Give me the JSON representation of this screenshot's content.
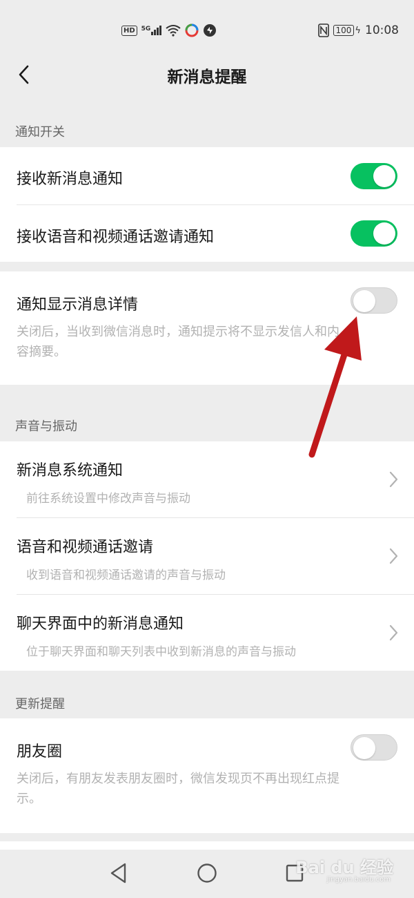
{
  "status_bar": {
    "hd": "HD",
    "network": "5G",
    "battery": "100",
    "time": "10:08"
  },
  "header": {
    "title": "新消息提醒"
  },
  "sections": {
    "notify_switch": {
      "label": "通知开关",
      "receive_new": {
        "title": "接收新消息通知",
        "enabled": true
      },
      "receive_call": {
        "title": "接收语音和视频通话邀请通知",
        "enabled": true
      },
      "show_details": {
        "title": "通知显示消息详情",
        "enabled": false,
        "desc_line1": "关闭后，当收到微信消息时，通知提示将不显示发信人和内",
        "desc_line2": "容摘要。"
      }
    },
    "sound_vibration": {
      "label": "声音与振动",
      "items": [
        {
          "title": "新消息系统通知",
          "subtitle": "前往系统设置中修改声音与振动"
        },
        {
          "title": "语音和视频通话邀请",
          "subtitle": "收到语音和视频通话邀请的声音与振动"
        },
        {
          "title": "聊天界面中的新消息通知",
          "subtitle": "位于聊天界面和聊天列表中收到新消息的声音与振动"
        }
      ]
    },
    "update_reminder": {
      "label": "更新提醒",
      "moments": {
        "title": "朋友圈",
        "enabled": false,
        "desc_line1": "关闭后，有朋友发表朋友圈时，微信发现页不再出现红点提",
        "desc_line2": "示。"
      }
    }
  },
  "watermark": {
    "brand": "Bai du 经验",
    "url": "jingyan.baidu.com"
  },
  "colors": {
    "toggle_on": "#07c160",
    "annotation_arrow": "#c0191b"
  }
}
